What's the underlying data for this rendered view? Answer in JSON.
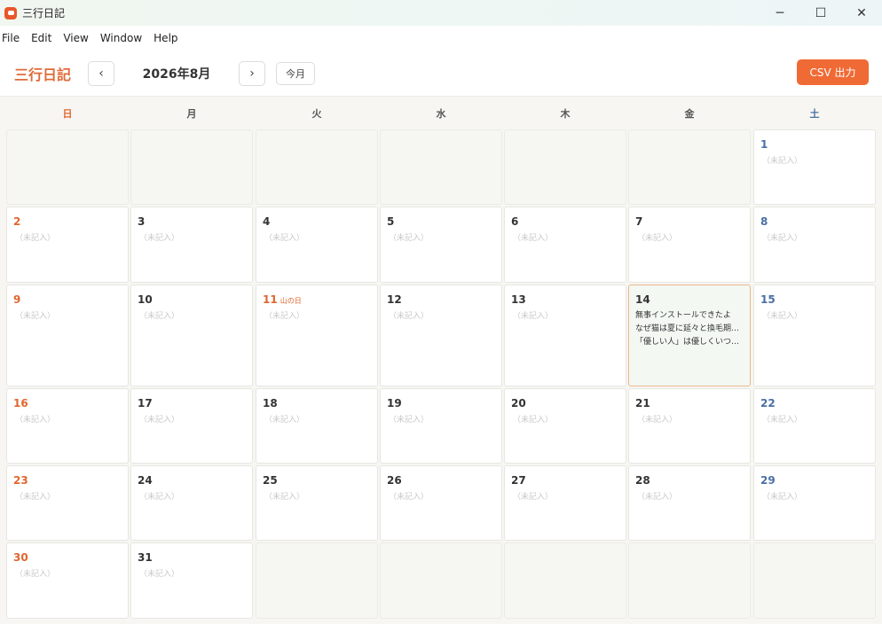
{
  "window": {
    "title": "三行日記",
    "controls": [
      "─",
      "☐",
      "✕"
    ]
  },
  "menu": [
    "File",
    "Edit",
    "View",
    "Window",
    "Help"
  ],
  "header": {
    "brand": "三行日記",
    "prev": "‹",
    "next": "›",
    "month": "2026年8月",
    "today": "今月",
    "csv": "CSV 出力"
  },
  "colors": {
    "accent": "#f06a35",
    "sunday": "#e0662f",
    "saturday": "#4a6fa5",
    "today_border": "#eab98c"
  },
  "weekdays": [
    "日",
    "月",
    "火",
    "水",
    "木",
    "金",
    "土"
  ],
  "placeholder": "（未記入）",
  "calendar": {
    "lead_blanks": 6,
    "trail_blanks": 5,
    "days": [
      {
        "n": "1"
      },
      {
        "n": "2"
      },
      {
        "n": "3"
      },
      {
        "n": "4"
      },
      {
        "n": "5"
      },
      {
        "n": "6"
      },
      {
        "n": "7"
      },
      {
        "n": "8"
      },
      {
        "n": "9"
      },
      {
        "n": "10"
      },
      {
        "n": "11",
        "holiday": "山の日"
      },
      {
        "n": "12"
      },
      {
        "n": "13"
      },
      {
        "n": "14",
        "today": true,
        "entries": [
          "無事インストールできたよ",
          "なぜ猫は夏に延々と換毛期…",
          "「優しい人」は優しくいつづけ…"
        ]
      },
      {
        "n": "15"
      },
      {
        "n": "16"
      },
      {
        "n": "17"
      },
      {
        "n": "18"
      },
      {
        "n": "19"
      },
      {
        "n": "20"
      },
      {
        "n": "21"
      },
      {
        "n": "22"
      },
      {
        "n": "23"
      },
      {
        "n": "24"
      },
      {
        "n": "25"
      },
      {
        "n": "26"
      },
      {
        "n": "27"
      },
      {
        "n": "28"
      },
      {
        "n": "29"
      },
      {
        "n": "30"
      },
      {
        "n": "31"
      }
    ]
  }
}
